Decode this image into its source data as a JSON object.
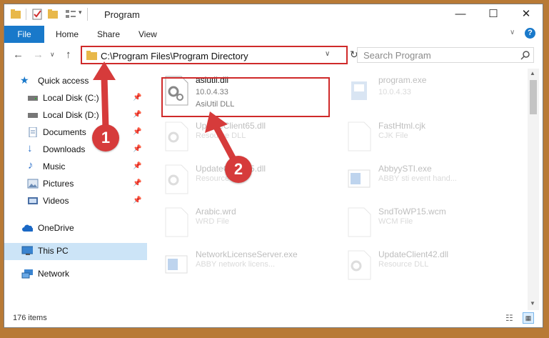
{
  "window": {
    "title": "Program"
  },
  "ribbon": {
    "tabs": [
      "File",
      "Home",
      "Share",
      "View"
    ]
  },
  "address": {
    "path": "C:\\Program Files\\Program Directory"
  },
  "search": {
    "placeholder": "Search Program"
  },
  "sidebar": {
    "items": [
      {
        "label": "Quick access",
        "icon": "star-icon"
      },
      {
        "label": "Local Disk (C:)",
        "icon": "drive-icon"
      },
      {
        "label": "Local Disk (D:)",
        "icon": "drive-icon"
      },
      {
        "label": "Documents",
        "icon": "documents-icon"
      },
      {
        "label": "Downloads",
        "icon": "download-arrow-icon"
      },
      {
        "label": "Music",
        "icon": "music-note-icon"
      },
      {
        "label": "Pictures",
        "icon": "pictures-icon"
      },
      {
        "label": "Videos",
        "icon": "videos-icon"
      },
      {
        "label": "OneDrive",
        "icon": "cloud-icon"
      },
      {
        "label": "This PC",
        "icon": "computer-icon"
      },
      {
        "label": "Network",
        "icon": "network-icon"
      }
    ]
  },
  "files": [
    {
      "name": "asiutil.dll",
      "line2": "10.0.4.33",
      "line3": "AsiUtil DLL",
      "icon": "gear-file-icon"
    },
    {
      "name": "program.exe",
      "line2": "10.0.4.33",
      "line3": "",
      "icon": "installer-icon"
    },
    {
      "name": "UpdateClient65.dll",
      "line2": "Resource DLL",
      "icon": "gear-file-icon"
    },
    {
      "name": "FastHtml.cjk",
      "line2": "CJK File",
      "icon": "blank-file-icon"
    },
    {
      "name": "UpdateClient65.dll",
      "line2": "Resource DLL",
      "icon": "gear-file-icon"
    },
    {
      "name": "AbbyySTI.exe",
      "line2": "ABBY sti event hand...",
      "icon": "exe-window-icon"
    },
    {
      "name": "Arabic.wrd",
      "line2": "WRD File",
      "icon": "blank-file-icon"
    },
    {
      "name": "SndToWP15.wcm",
      "line2": "WCM File",
      "icon": "blank-file-icon"
    },
    {
      "name": "NetworkLicenseServer.exe",
      "line2": "ABBY network licens...",
      "icon": "exe-window-icon"
    },
    {
      "name": "UpdateClient42.dll",
      "line2": "Resource DLL",
      "icon": "gear-file-icon"
    }
  ],
  "status": {
    "count": "176 items"
  },
  "callouts": [
    "1",
    "2"
  ],
  "colors": {
    "accent": "#1979ca",
    "highlight": "#cf2a2a",
    "callout": "#d63b3b"
  }
}
